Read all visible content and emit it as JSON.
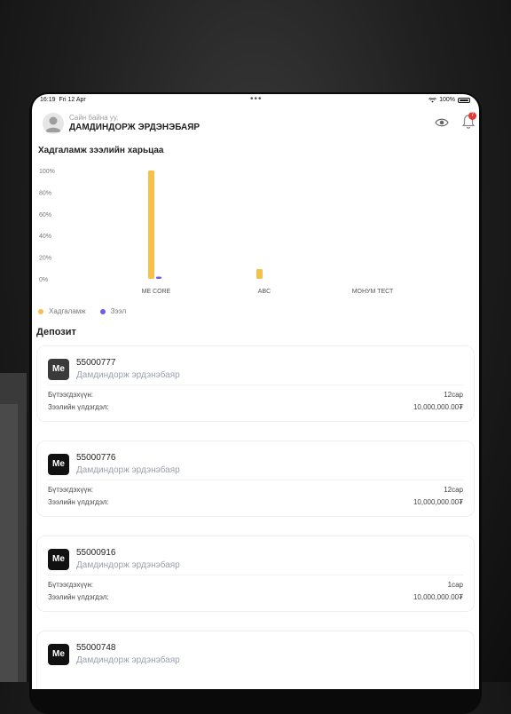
{
  "status_bar": {
    "time": "16:19",
    "date": "Fri 12 Apr",
    "battery": "100%"
  },
  "header": {
    "greeting": "Сайн байна уу,",
    "user_name": "ДАМДИНДОРЖ ЭРДЭНЭБАЯР",
    "notification_count": "7"
  },
  "chart_title": "Хадгаламж зээлийн харьцаа",
  "chart_data": {
    "type": "bar",
    "categories": [
      "ME CORE",
      "ABC",
      "МОНУМ ТЕСТ"
    ],
    "series": [
      {
        "name": "Хадгаламж",
        "values": [
          100,
          9,
          0
        ],
        "color": "#f8c04a"
      },
      {
        "name": "Зээл",
        "values": [
          2,
          0,
          0
        ],
        "color": "#6c5ce7"
      }
    ],
    "yticks": [
      "100%",
      "80%",
      "60%",
      "40%",
      "20%",
      "0%"
    ],
    "ylim": [
      0,
      100
    ],
    "legend": "bottom-left"
  },
  "section_title": "Депозит",
  "deposits": [
    {
      "logo": "Me",
      "account": "55000777",
      "owner": "Дамдиндорж эрдэнэбаяр",
      "term_label": "Бүтээгдэхүүн:",
      "term_value": "12сар",
      "balance_label": "Зээлийн үлдэгдэл:",
      "balance_value": "10,000,000.00₮"
    },
    {
      "logo": "Me",
      "account": "55000776",
      "owner": "Дамдиндорж эрдэнэбаяр",
      "term_label": "Бүтээгдэхүүн:",
      "term_value": "12сар",
      "balance_label": "Зээлийн үлдэгдэл:",
      "balance_value": "10,000,000.00₮"
    },
    {
      "logo": "Me",
      "account": "55000916",
      "owner": "Дамдиндорж эрдэнэбаяр",
      "term_label": "Бүтээгдэхүүн:",
      "term_value": "1сар",
      "balance_label": "Зээлийн үлдэгдэл:",
      "balance_value": "10,000,000.00₮"
    },
    {
      "logo": "Me",
      "account": "55000748",
      "owner": "Дамдиндорж эрдэнэбаяр",
      "term_label": "",
      "term_value": "",
      "balance_label": "",
      "balance_value": ""
    }
  ]
}
